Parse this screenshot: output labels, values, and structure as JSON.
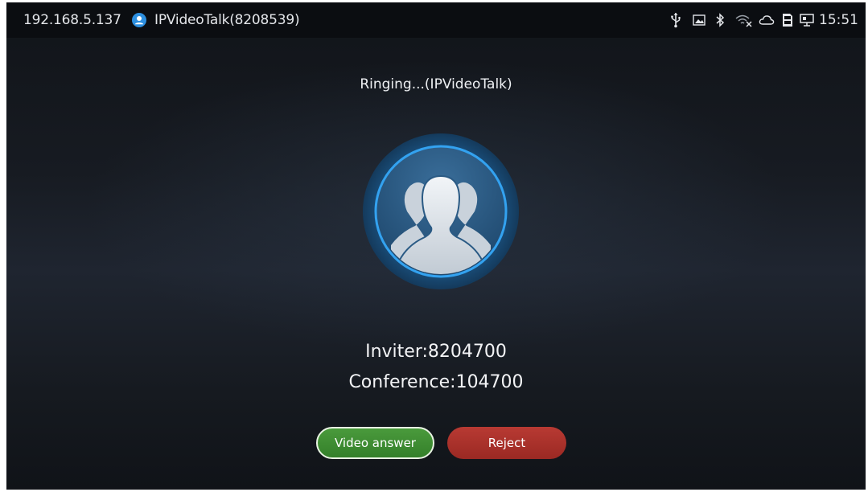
{
  "status_bar": {
    "ip_address": "192.168.5.137",
    "account_name": "IPVideoTalk(8208539)",
    "time": "15:51",
    "icons": [
      "usb-icon",
      "screen-capture-icon",
      "bluetooth-icon",
      "wifi-disabled-icon",
      "cloud-icon",
      "sd-card-icon",
      "display-icon"
    ]
  },
  "call": {
    "status_text": "Ringing...(IPVideoTalk)",
    "inviter": "Inviter:8204700",
    "conference": "Conference:104700"
  },
  "actions": {
    "answer_label": "Video answer",
    "reject_label": "Reject"
  },
  "colors": {
    "answer": "#3f8f33",
    "reject": "#ab322c",
    "avatar_ring": "#2a8fd8",
    "status_bar": "#0b0d11"
  }
}
